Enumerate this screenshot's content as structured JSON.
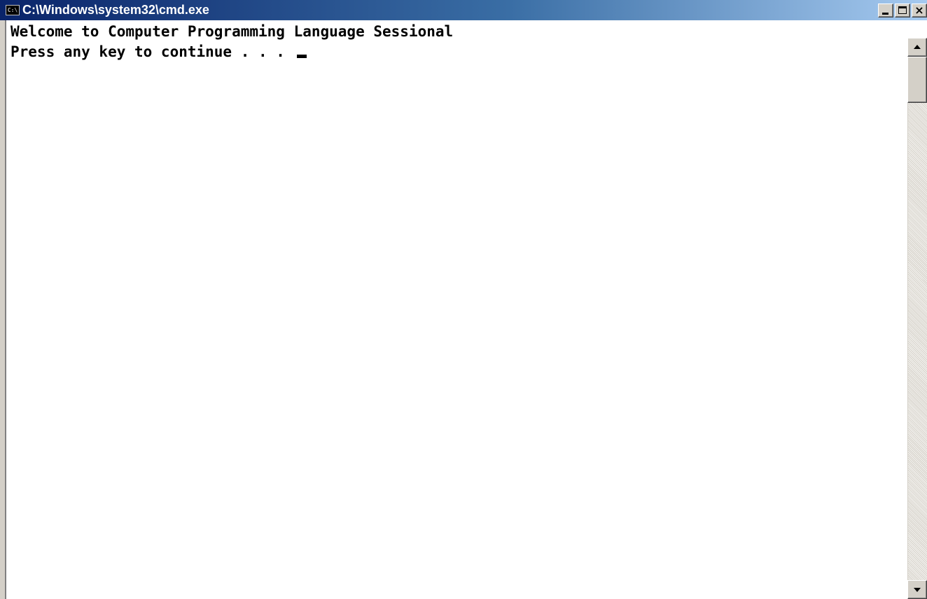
{
  "window": {
    "title": "C:\\Windows\\system32\\cmd.exe",
    "icon": "cmd-icon",
    "icon_text": "C:\\",
    "title_gradient": [
      "#0a246a",
      "#3a6ea5",
      "#a6caf0"
    ]
  },
  "controls": {
    "minimize_icon": "minimize-icon",
    "maximize_icon": "maximize-icon",
    "close_icon": "close-icon",
    "close_glyph": "×"
  },
  "console": {
    "lines": [
      "Welcome to Computer Programming Language Sessional",
      "Press any key to continue . . . "
    ],
    "background": "#ffffff",
    "foreground": "#000000",
    "cursor": "underscore-cursor"
  },
  "scrollbar": {
    "up_icon": "arrow-up-icon",
    "down_icon": "arrow-down-icon"
  }
}
